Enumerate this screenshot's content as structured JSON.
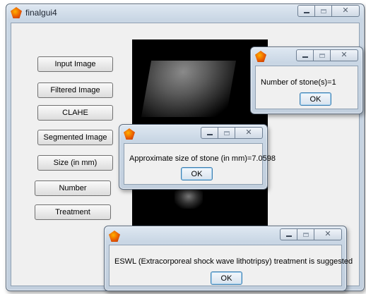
{
  "main_window": {
    "title": "finalgui4",
    "buttons": [
      {
        "label": "Input Image"
      },
      {
        "label": "Filtered Image"
      },
      {
        "label": "CLAHE"
      },
      {
        "label": "Segmented Image"
      },
      {
        "label": "Size (in mm)"
      },
      {
        "label": "Number"
      },
      {
        "label": "Treatment"
      }
    ]
  },
  "dialogs": {
    "stone_count": {
      "message": "Number of stone(s)=1",
      "ok_label": "OK"
    },
    "stone_size": {
      "message": "Approximate size of stone (in mm)=7.0598",
      "ok_label": "OK"
    },
    "treatment": {
      "message": "ESWL (Extracorporeal shock wave lithotripsy) treatment is suggested",
      "ok_label": "OK"
    }
  },
  "icons": {
    "window_icon": "matlab-icon",
    "minimize": "minimize-icon",
    "maximize": "maximize-icon",
    "close": "close-icon"
  }
}
